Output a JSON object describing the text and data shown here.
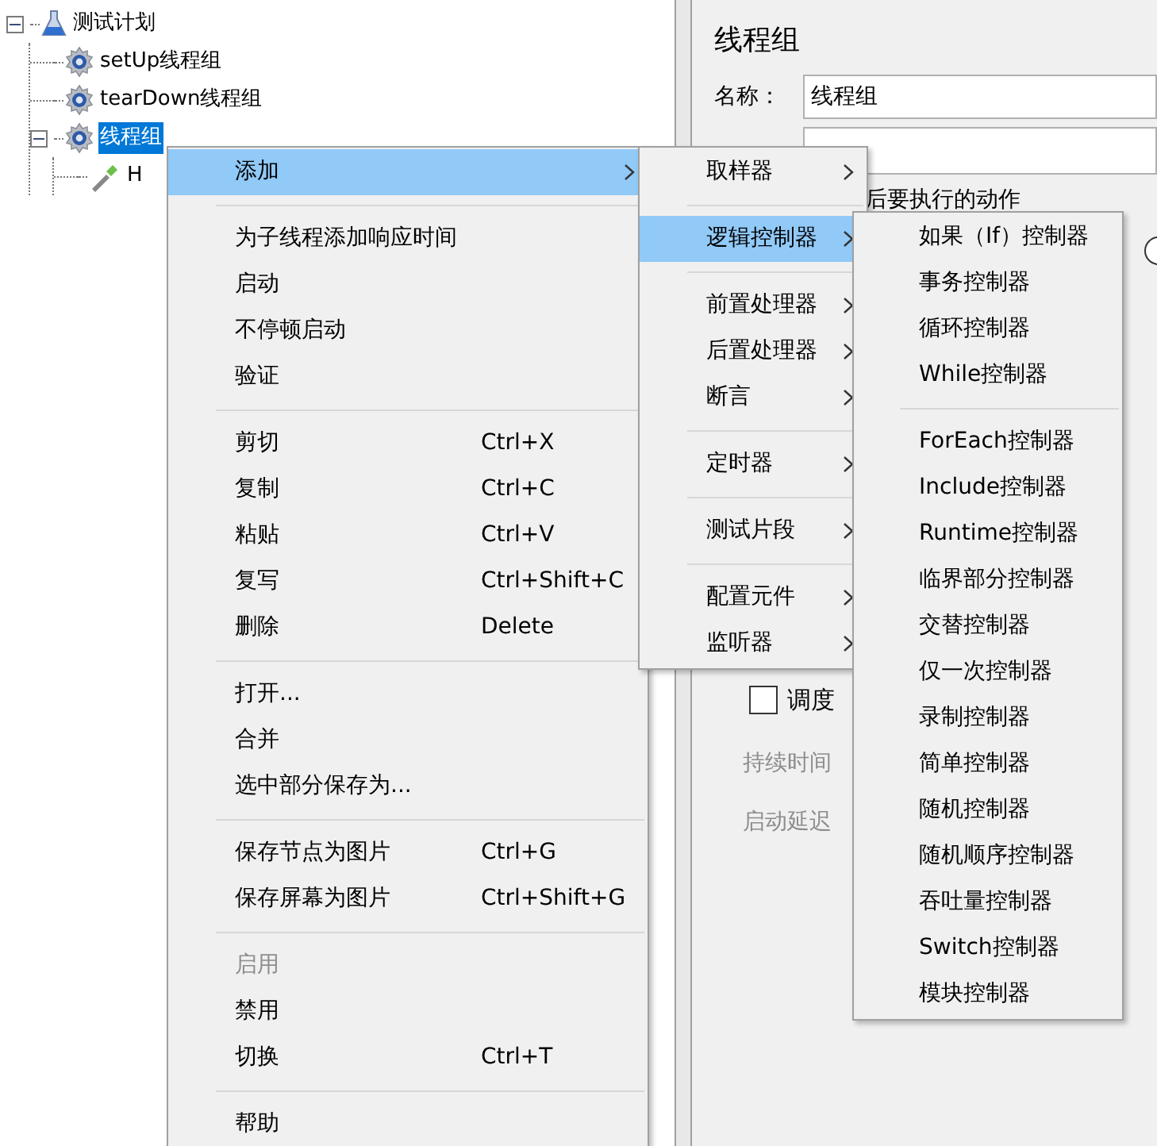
{
  "tree": [
    {
      "label": "测试计划",
      "kind": "plan",
      "expanded": true,
      "selected": false,
      "children": [
        {
          "label": "setUp线程组",
          "kind": "group",
          "selected": false
        },
        {
          "label": "tearDown线程组",
          "kind": "group",
          "selected": false
        },
        {
          "label": "线程组",
          "kind": "group",
          "expanded": true,
          "selected": true,
          "children": [
            {
              "label": "H",
              "kind": "sampler",
              "selected": false
            }
          ]
        }
      ]
    }
  ],
  "panel": {
    "title": "线程组",
    "name_label": "名称：",
    "name_value": "线程组",
    "section_label": "后要执行的动作",
    "radio": {
      "checked": false
    },
    "scheduler": {
      "label": "调度",
      "checked": false
    },
    "duration_label": "持续时间",
    "delay_label": "启动延迟"
  },
  "context_menu": [
    {
      "kind": "item",
      "label": "添加",
      "submenu": true,
      "selected": true,
      "disabled": false
    },
    {
      "kind": "separator"
    },
    {
      "kind": "item",
      "label": "为子线程添加响应时间",
      "selected": false,
      "disabled": false
    },
    {
      "kind": "item",
      "label": "启动",
      "selected": false,
      "disabled": false
    },
    {
      "kind": "item",
      "label": "不停顿启动",
      "selected": false,
      "disabled": false
    },
    {
      "kind": "item",
      "label": "验证",
      "selected": false,
      "disabled": false
    },
    {
      "kind": "separator"
    },
    {
      "kind": "item",
      "label": "剪切",
      "shortcut": "Ctrl+X",
      "selected": false,
      "disabled": false
    },
    {
      "kind": "item",
      "label": "复制",
      "shortcut": "Ctrl+C",
      "selected": false,
      "disabled": false
    },
    {
      "kind": "item",
      "label": "粘贴",
      "shortcut": "Ctrl+V",
      "selected": false,
      "disabled": false
    },
    {
      "kind": "item",
      "label": "复写",
      "shortcut": "Ctrl+Shift+C",
      "selected": false,
      "disabled": false
    },
    {
      "kind": "item",
      "label": "删除",
      "shortcut": "Delete",
      "selected": false,
      "disabled": false
    },
    {
      "kind": "separator"
    },
    {
      "kind": "item",
      "label": "打开...",
      "selected": false,
      "disabled": false
    },
    {
      "kind": "item",
      "label": "合并",
      "selected": false,
      "disabled": false
    },
    {
      "kind": "item",
      "label": "选中部分保存为...",
      "selected": false,
      "disabled": false
    },
    {
      "kind": "separator"
    },
    {
      "kind": "item",
      "label": "保存节点为图片",
      "shortcut": "Ctrl+G",
      "selected": false,
      "disabled": false
    },
    {
      "kind": "item",
      "label": "保存屏幕为图片",
      "shortcut": "Ctrl+Shift+G",
      "selected": false,
      "disabled": false
    },
    {
      "kind": "separator"
    },
    {
      "kind": "item",
      "label": "启用",
      "selected": false,
      "disabled": true
    },
    {
      "kind": "item",
      "label": "禁用",
      "selected": false,
      "disabled": false
    },
    {
      "kind": "item",
      "label": "切换",
      "shortcut": "Ctrl+T",
      "selected": false,
      "disabled": false
    },
    {
      "kind": "separator"
    },
    {
      "kind": "item",
      "label": "帮助",
      "selected": false,
      "disabled": false
    }
  ],
  "add_submenu": [
    {
      "kind": "item",
      "label": "取样器",
      "submenu": true,
      "selected": false
    },
    {
      "kind": "separator"
    },
    {
      "kind": "item",
      "label": "逻辑控制器",
      "submenu": true,
      "selected": true
    },
    {
      "kind": "separator"
    },
    {
      "kind": "item",
      "label": "前置处理器",
      "submenu": true,
      "selected": false
    },
    {
      "kind": "item",
      "label": "后置处理器",
      "submenu": true,
      "selected": false
    },
    {
      "kind": "item",
      "label": "断言",
      "submenu": true,
      "selected": false
    },
    {
      "kind": "separator"
    },
    {
      "kind": "item",
      "label": "定时器",
      "submenu": true,
      "selected": false
    },
    {
      "kind": "separator"
    },
    {
      "kind": "item",
      "label": "测试片段",
      "submenu": true,
      "selected": false
    },
    {
      "kind": "separator"
    },
    {
      "kind": "item",
      "label": "配置元件",
      "submenu": true,
      "selected": false
    },
    {
      "kind": "item",
      "label": "监听器",
      "submenu": true,
      "selected": false
    }
  ],
  "logic_submenu": [
    {
      "kind": "item",
      "label": "如果（If）控制器",
      "selected": false
    },
    {
      "kind": "item",
      "label": "事务控制器",
      "selected": false
    },
    {
      "kind": "item",
      "label": "循环控制器",
      "selected": false
    },
    {
      "kind": "item",
      "label": "While控制器",
      "selected": false
    },
    {
      "kind": "separator"
    },
    {
      "kind": "item",
      "label": "ForEach控制器",
      "selected": false
    },
    {
      "kind": "item",
      "label": "Include控制器",
      "selected": false
    },
    {
      "kind": "item",
      "label": "Runtime控制器",
      "selected": false
    },
    {
      "kind": "item",
      "label": "临界部分控制器",
      "selected": false
    },
    {
      "kind": "item",
      "label": "交替控制器",
      "selected": false
    },
    {
      "kind": "item",
      "label": "仅一次控制器",
      "selected": false
    },
    {
      "kind": "item",
      "label": "录制控制器",
      "selected": false
    },
    {
      "kind": "item",
      "label": "简单控制器",
      "selected": false
    },
    {
      "kind": "item",
      "label": "随机控制器",
      "selected": false
    },
    {
      "kind": "item",
      "label": "随机顺序控制器",
      "selected": false
    },
    {
      "kind": "item",
      "label": "吞吐量控制器",
      "selected": false
    },
    {
      "kind": "item",
      "label": "Switch控制器",
      "selected": false
    },
    {
      "kind": "item",
      "label": "模块控制器",
      "selected": false
    }
  ]
}
